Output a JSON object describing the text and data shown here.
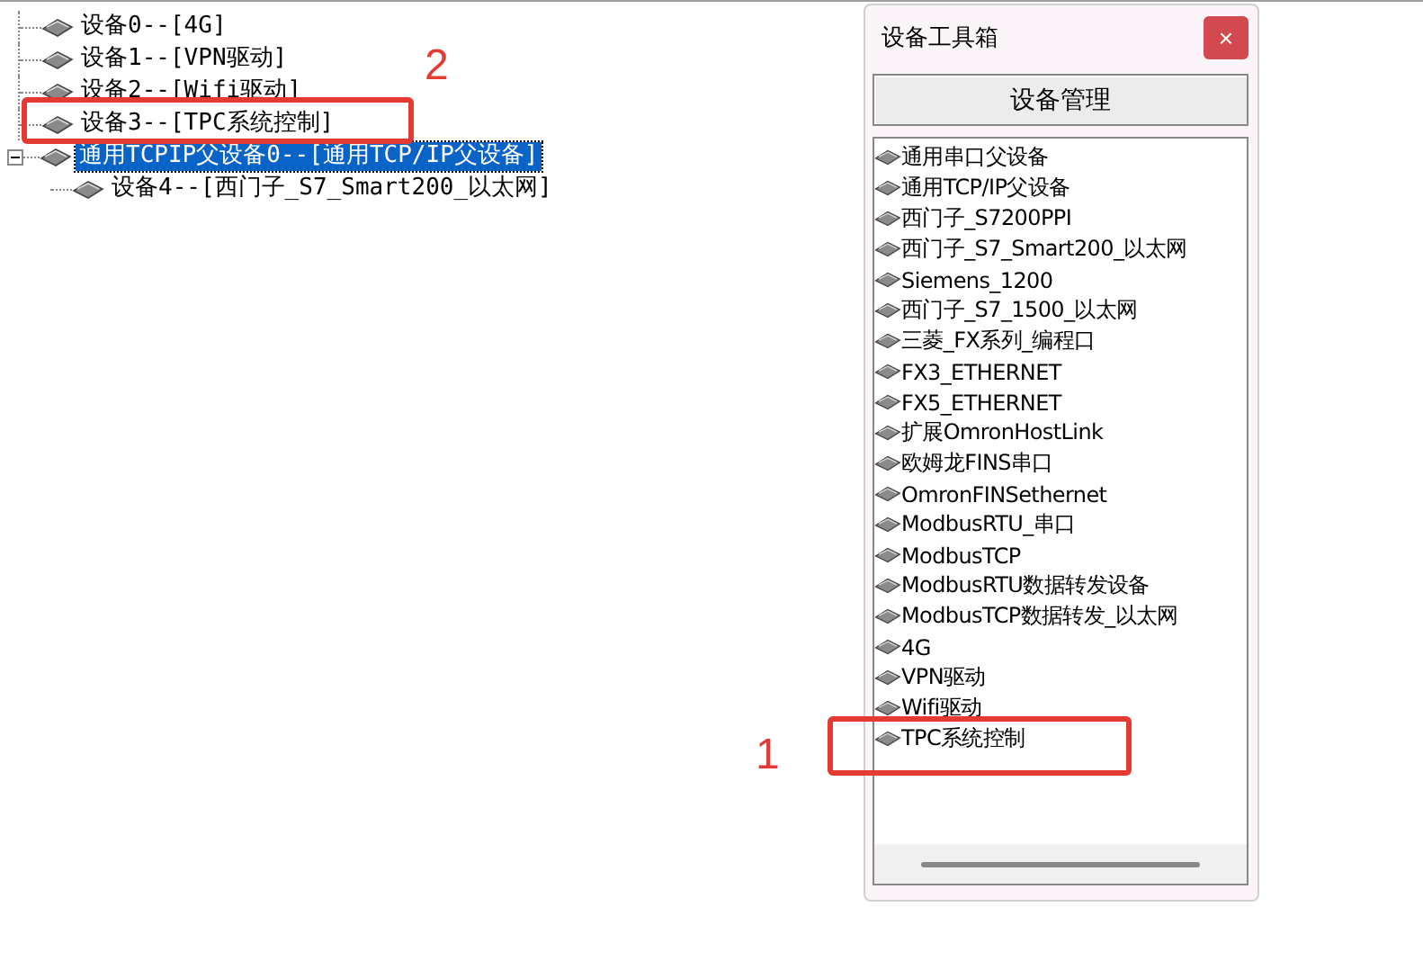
{
  "tree": [
    {
      "label": "设备0--[4G]",
      "selected": false
    },
    {
      "label": "设备1--[VPN驱动]",
      "selected": false
    },
    {
      "label": "设备2--[Wifi驱动]",
      "selected": false
    },
    {
      "label": "设备3--[TPC系统控制]",
      "selected": false
    },
    {
      "label": "通用TCPIP父设备0--[通用TCP/IP父设备]",
      "selected": true,
      "expanded": true,
      "children": [
        {
          "label": "设备4--[西门子_S7_Smart200_以太网]",
          "selected": false
        }
      ]
    }
  ],
  "toolbox": {
    "title": "设备工具箱",
    "close": "×",
    "manage_button": "设备管理",
    "items": [
      "通用串口父设备",
      "通用TCP/IP父设备",
      "西门子_S7200PPI",
      "西门子_S7_Smart200_以太网",
      "Siemens_1200",
      "西门子_S7_1500_以太网",
      "三菱_FX系列_编程口",
      "FX3_ETHERNET",
      "FX5_ETHERNET",
      "扩展OmronHostLink",
      "欧姆龙FINS串口",
      "OmronFINSethernet",
      "ModbusRTU_串口",
      "ModbusTCP",
      "ModbusRTU数据转发设备",
      "ModbusTCP数据转发_以太网",
      "4G",
      "VPN驱动",
      "Wifi驱动",
      "TPC系统控制"
    ]
  },
  "annotations": [
    {
      "label": "2"
    },
    {
      "label": "1"
    }
  ]
}
